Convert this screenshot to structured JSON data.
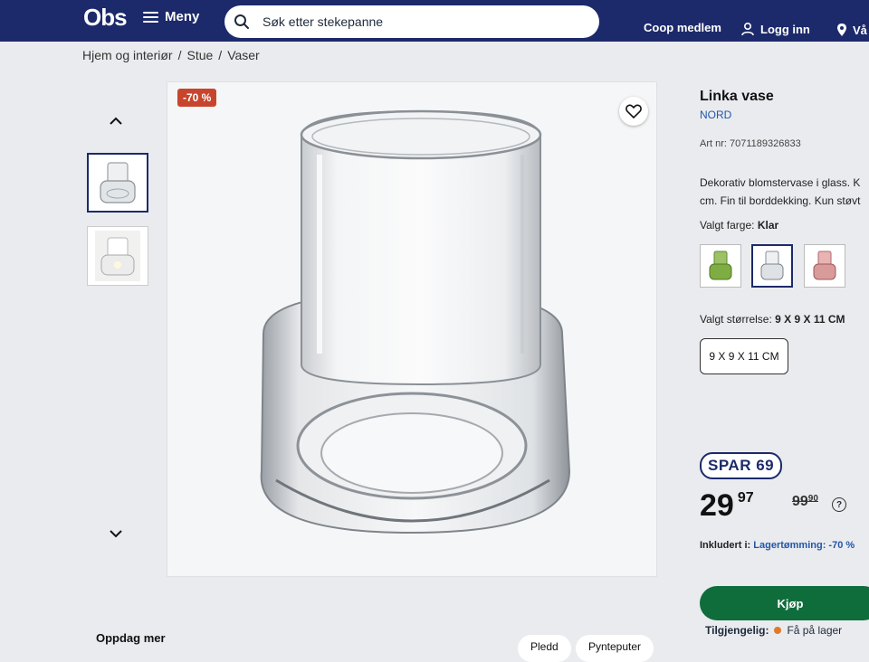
{
  "header": {
    "logo": "Obs",
    "menu_label": "Meny",
    "search_placeholder": "Søk etter stekepanne",
    "coop_label": "Coop medlem",
    "login_label": "Logg inn",
    "store_label": "Vå"
  },
  "breadcrumb": [
    "Hjem og interiør",
    "/",
    "Stue",
    "/",
    "Vaser"
  ],
  "gallery": {
    "badge": "-70 %"
  },
  "product": {
    "name": "Linka vase",
    "brand": "NORD",
    "art_nr": "Art nr: 7071189326833",
    "description_line1": "Dekorativ blomstervase i glass. K",
    "description_line2": "cm. Fin til borddekking. Kun støvt",
    "color_label": "Valgt farge:",
    "color_value": "Klar",
    "size_label": "Valgt størrelse:",
    "size_value": "9 X 9 X 11 CM",
    "size_button": "9 X 9 X 11 CM",
    "spar_badge": "SPAR 69",
    "price_main": "29",
    "price_cents": "97",
    "old_price_main": "99",
    "old_price_cents": "90",
    "included_label": "Inkludert i:",
    "included_value": "Lagertømming: -70 %",
    "buy_label": "Kjøp",
    "availability_label": "Tilgjengelig:",
    "availability_value": "Få på lager"
  },
  "bottom": {
    "discover_label": "Oppdag mer",
    "chips": [
      "Pledd",
      "Pynteputer"
    ]
  },
  "colors": {
    "header_bg": "#1c2a6b",
    "badge": "#c8452d",
    "buy_button": "#0f6d3c",
    "link": "#2456a8"
  }
}
